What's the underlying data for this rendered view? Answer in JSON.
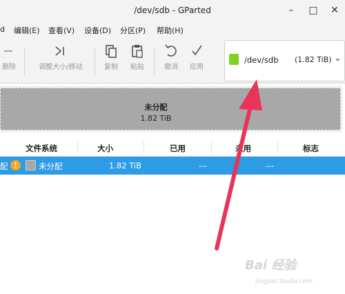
{
  "window": {
    "title": "/dev/sdb - GParted",
    "minimize_glyph": "–",
    "maximize_glyph": "□",
    "close_glyph": "✕"
  },
  "menu": [
    "d",
    "编辑(E)",
    "查看(V)",
    "设备(D)",
    "分区(P)",
    "帮助(H)"
  ],
  "toolbar": {
    "delete_label": "删除",
    "resize_label": "调整大小/移动",
    "copy_label": "复制",
    "paste_label": "粘贴",
    "undo_label": "撤消",
    "apply_label": "应用"
  },
  "device": {
    "name": "/dev/sdb",
    "size": "(1.82 TiB)",
    "color": "#7ed321"
  },
  "graph": {
    "label": "未分配",
    "size": "1.82 TiB",
    "color": "#a8a8a8"
  },
  "columns": [
    "文件系统",
    "大小",
    "已用",
    "未用",
    "标志"
  ],
  "rows": [
    {
      "partition": "配",
      "filesystem": "未分配",
      "size": "1.82 TiB",
      "used": "---",
      "unused": "---",
      "flags": ""
    }
  ],
  "colors": {
    "selection": "#2d9be6",
    "arrow": "#e8345a",
    "warning": "#f5a623"
  },
  "watermark": {
    "brand": "Bai 经验",
    "url": "jingyan.baidu.com"
  }
}
